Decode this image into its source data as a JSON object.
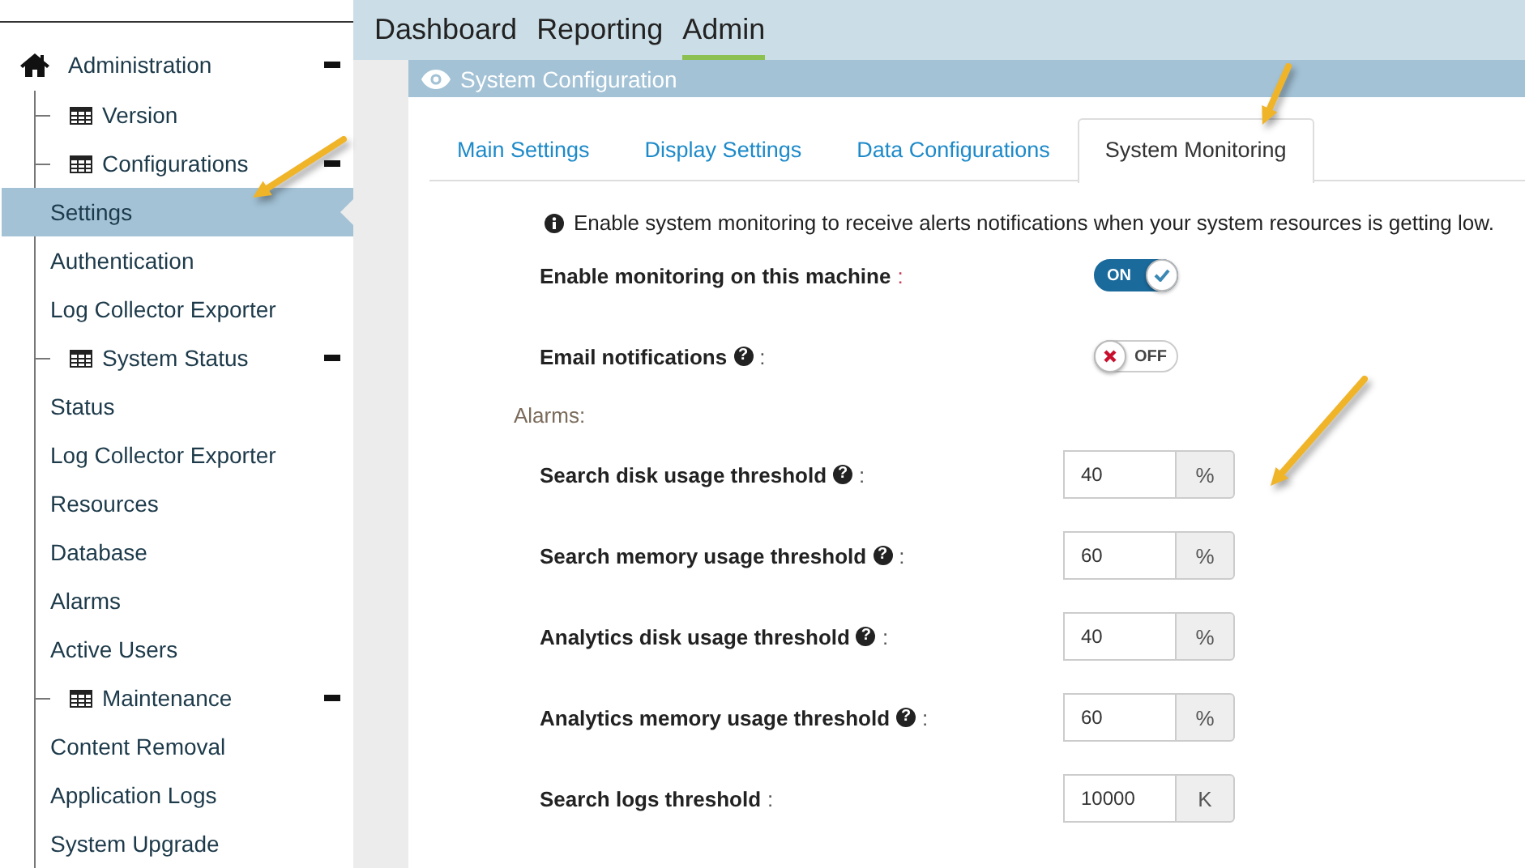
{
  "nav": [
    {
      "label": "Dashboard",
      "selected": false
    },
    {
      "label": "Reporting",
      "selected": false
    },
    {
      "label": "Admin",
      "selected": true
    }
  ],
  "sidebar": {
    "label": "Administration",
    "expanded": true,
    "children": [
      {
        "label": "Version",
        "kind": "group"
      },
      {
        "label": "Configurations",
        "kind": "group",
        "expanded": true,
        "children": [
          {
            "label": "Settings",
            "selected": true,
            "annotated": true
          },
          {
            "label": "Authentication",
            "selected": false
          },
          {
            "label": "Log Collector Exporter",
            "selected": false
          }
        ]
      },
      {
        "label": "System Status",
        "kind": "group",
        "expanded": true,
        "children": [
          {
            "label": "Status",
            "selected": false
          },
          {
            "label": "Log Collector Exporter",
            "selected": false
          },
          {
            "label": "Resources",
            "selected": false
          },
          {
            "label": "Database",
            "selected": false
          },
          {
            "label": "Alarms",
            "selected": false
          },
          {
            "label": "Active Users",
            "selected": false
          }
        ]
      },
      {
        "label": "Maintenance",
        "kind": "group",
        "expanded": true,
        "children": [
          {
            "label": "Content Removal",
            "selected": false
          },
          {
            "label": "Application Logs",
            "selected": false
          },
          {
            "label": "System Upgrade",
            "selected": false
          }
        ]
      }
    ]
  },
  "panel": {
    "title": "System Configuration",
    "tabs": [
      {
        "label": "Main Settings",
        "selected": false
      },
      {
        "label": "Display Settings",
        "selected": false
      },
      {
        "label": "Data Configurations",
        "selected": false
      },
      {
        "label": "System Monitoring",
        "selected": true,
        "annotated": true
      }
    ],
    "info": "Enable system monitoring to receive alerts notifications when your system resources is getting low.",
    "toggles": [
      {
        "label": "Enable monitoring on this machine",
        "suffix": ":",
        "on": true,
        "text": "ON"
      },
      {
        "label": "Email notifications",
        "help": "?",
        "suffix": ":",
        "on": false,
        "text": "OFF"
      }
    ],
    "alarms_label": "Alarms:",
    "thresholds": [
      {
        "label": "Search disk usage threshold",
        "help": "?",
        "suffix": ":",
        "value": "40",
        "unit": "%",
        "annotated": true
      },
      {
        "label": "Search memory usage threshold",
        "help": "?",
        "suffix": ":",
        "value": "60",
        "unit": "%"
      },
      {
        "label": "Analytics disk usage threshold",
        "help": "?",
        "suffix": ":",
        "value": "40",
        "unit": "%"
      },
      {
        "label": "Analytics memory usage threshold",
        "help": "?",
        "suffix": ":",
        "value": "60",
        "unit": "%"
      },
      {
        "label": "Search logs threshold",
        "suffix": ":",
        "value": "10000",
        "unit": "K"
      }
    ]
  }
}
